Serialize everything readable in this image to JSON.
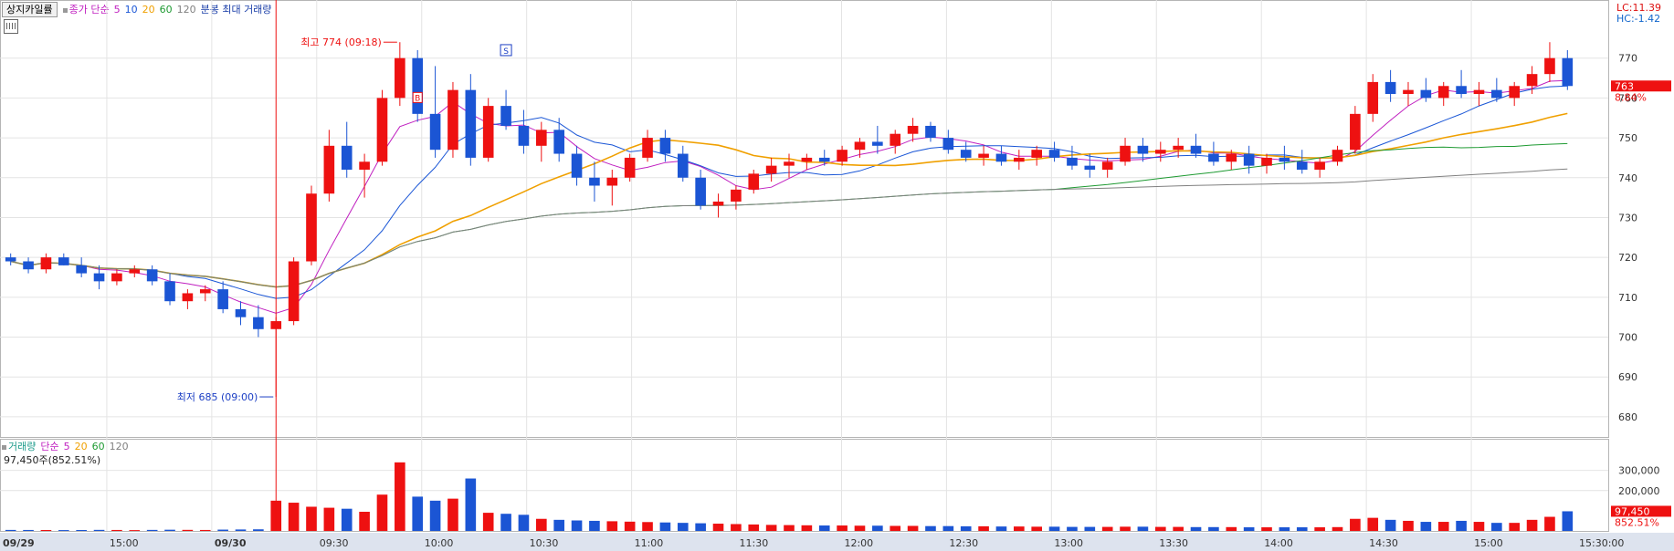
{
  "toolbar": {
    "mode_button": "상지카일률",
    "main_legend": [
      {
        "text": "종가 단순",
        "color": "#c020c0"
      },
      {
        "text": "5",
        "color": "#c020c0"
      },
      {
        "text": "10",
        "color": "#1a56d6"
      },
      {
        "text": "20",
        "color": "#f0a000"
      },
      {
        "text": "60",
        "color": "#1e9a32"
      },
      {
        "text": "120",
        "color": "#808080"
      },
      {
        "text": "분봉 최대 거래량",
        "color": "#1a3ea8"
      }
    ]
  },
  "price_labels": {
    "lc": "LC:11.39",
    "hc": "HC:-1.42",
    "high": "최고 774 (09:18)",
    "low": "최저 685 (09:00)",
    "buy_marker": "B",
    "sell_marker": "S",
    "current_price": "763",
    "current_pct": "8.84%"
  },
  "volume_panel": {
    "legend": [
      {
        "text": "거래량",
        "color": "#1a9a8a"
      },
      {
        "text": "단순",
        "color": "#c020c0"
      },
      {
        "text": "5",
        "color": "#c020c0"
      },
      {
        "text": "20",
        "color": "#f0a000"
      },
      {
        "text": "60",
        "color": "#1e9a32"
      },
      {
        "text": "120",
        "color": "#808080"
      }
    ],
    "info": "97,450주(852.51%)",
    "current_volume": "97,450",
    "current_pct": "852.51%"
  },
  "chart_data": {
    "type": "candlestick",
    "price_axis": {
      "ticks": [
        "770",
        "760",
        "750",
        "740",
        "730",
        "720",
        "710",
        "700",
        "690",
        "680"
      ],
      "ylim": [
        677,
        780
      ]
    },
    "volume_axis": {
      "ticks": [
        "300,000",
        "200,000"
      ],
      "ylim": [
        0,
        380000
      ]
    },
    "time_axis": {
      "labels": [
        "09/29",
        "15:00",
        "09/30",
        "09:30",
        "10:00",
        "10:30",
        "11:00",
        "11:30",
        "12:00",
        "12:30",
        "13:00",
        "13:30",
        "14:00",
        "14:30",
        "15:00",
        "15:30:00"
      ]
    },
    "candles": [
      [
        720,
        721,
        718,
        719,
        5000
      ],
      [
        719,
        720,
        716,
        717,
        4800
      ],
      [
        717,
        721,
        716,
        720,
        4500
      ],
      [
        720,
        721,
        718,
        718,
        4200
      ],
      [
        718,
        720,
        715,
        716,
        4600
      ],
      [
        716,
        718,
        712,
        714,
        5200
      ],
      [
        714,
        717,
        713,
        716,
        4800
      ],
      [
        716,
        718,
        715,
        717,
        4000
      ],
      [
        717,
        718,
        713,
        714,
        5100
      ],
      [
        714,
        716,
        708,
        709,
        6000
      ],
      [
        709,
        712,
        707,
        711,
        5300
      ],
      [
        711,
        713,
        709,
        712,
        4800
      ],
      [
        712,
        714,
        706,
        707,
        6500
      ],
      [
        707,
        709,
        703,
        705,
        7200
      ],
      [
        705,
        708,
        700,
        702,
        8000
      ],
      [
        702,
        705,
        685,
        704,
        150000
      ],
      [
        704,
        720,
        703,
        719,
        140000
      ],
      [
        719,
        738,
        718,
        736,
        120000
      ],
      [
        736,
        752,
        734,
        748,
        115000
      ],
      [
        748,
        754,
        740,
        742,
        110000
      ],
      [
        742,
        746,
        735,
        744,
        95000
      ],
      [
        744,
        762,
        743,
        760,
        180000
      ],
      [
        760,
        774,
        758,
        770,
        340000
      ],
      [
        770,
        772,
        754,
        756,
        170000
      ],
      [
        756,
        768,
        745,
        747,
        150000
      ],
      [
        747,
        764,
        745,
        762,
        160000
      ],
      [
        762,
        766,
        743,
        745,
        260000
      ],
      [
        745,
        760,
        744,
        758,
        90000
      ],
      [
        758,
        762,
        752,
        753,
        85000
      ],
      [
        753,
        757,
        746,
        748,
        80000
      ],
      [
        748,
        754,
        744,
        752,
        60000
      ],
      [
        752,
        755,
        744,
        746,
        55000
      ],
      [
        746,
        748,
        738,
        740,
        52000
      ],
      [
        740,
        744,
        734,
        738,
        50000
      ],
      [
        738,
        742,
        733,
        740,
        48000
      ],
      [
        740,
        746,
        739,
        745,
        46000
      ],
      [
        745,
        752,
        744,
        750,
        44000
      ],
      [
        750,
        752,
        744,
        746,
        42000
      ],
      [
        746,
        748,
        739,
        740,
        40000
      ],
      [
        740,
        742,
        732,
        733,
        38000
      ],
      [
        733,
        736,
        730,
        734,
        36000
      ],
      [
        734,
        738,
        732,
        737,
        34000
      ],
      [
        737,
        742,
        736,
        741,
        32000
      ],
      [
        741,
        745,
        739,
        743,
        30000
      ],
      [
        743,
        746,
        740,
        744,
        29000
      ],
      [
        744,
        746,
        742,
        745,
        28000
      ],
      [
        745,
        747,
        743,
        744,
        27000
      ],
      [
        744,
        748,
        743,
        747,
        27000
      ],
      [
        747,
        750,
        745,
        749,
        26000
      ],
      [
        749,
        753,
        746,
        748,
        26000
      ],
      [
        748,
        752,
        746,
        751,
        25000
      ],
      [
        751,
        755,
        749,
        753,
        25000
      ],
      [
        753,
        754,
        749,
        750,
        24000
      ],
      [
        750,
        752,
        746,
        747,
        24000
      ],
      [
        747,
        749,
        744,
        745,
        23000
      ],
      [
        745,
        748,
        743,
        746,
        23000
      ],
      [
        746,
        748,
        743,
        744,
        22000
      ],
      [
        744,
        747,
        742,
        745,
        22000
      ],
      [
        745,
        748,
        743,
        747,
        21000
      ],
      [
        747,
        749,
        744,
        745,
        21000
      ],
      [
        745,
        748,
        742,
        743,
        20000
      ],
      [
        743,
        746,
        740,
        742,
        20000
      ],
      [
        742,
        745,
        740,
        744,
        20000
      ],
      [
        744,
        750,
        743,
        748,
        21000
      ],
      [
        748,
        750,
        744,
        746,
        21000
      ],
      [
        746,
        749,
        744,
        747,
        20000
      ],
      [
        747,
        750,
        745,
        748,
        20000
      ],
      [
        748,
        751,
        745,
        746,
        19000
      ],
      [
        746,
        749,
        743,
        744,
        19000
      ],
      [
        744,
        747,
        742,
        746,
        19000
      ],
      [
        746,
        748,
        741,
        743,
        18000
      ],
      [
        743,
        746,
        741,
        745,
        18000
      ],
      [
        745,
        748,
        742,
        744,
        18000
      ],
      [
        744,
        747,
        741,
        742,
        18000
      ],
      [
        742,
        745,
        740,
        744,
        18000
      ],
      [
        744,
        748,
        743,
        747,
        19000
      ],
      [
        747,
        758,
        746,
        756,
        60000
      ],
      [
        756,
        766,
        754,
        764,
        65000
      ],
      [
        764,
        767,
        759,
        761,
        55000
      ],
      [
        761,
        764,
        758,
        762,
        50000
      ],
      [
        762,
        765,
        759,
        760,
        45000
      ],
      [
        760,
        764,
        758,
        763,
        45000
      ],
      [
        763,
        767,
        760,
        761,
        50000
      ],
      [
        761,
        764,
        758,
        762,
        45000
      ],
      [
        762,
        765,
        759,
        760,
        40000
      ],
      [
        760,
        764,
        758,
        763,
        40000
      ],
      [
        763,
        768,
        761,
        766,
        55000
      ],
      [
        766,
        774,
        764,
        770,
        70000
      ],
      [
        770,
        772,
        762,
        763,
        97450
      ]
    ]
  }
}
